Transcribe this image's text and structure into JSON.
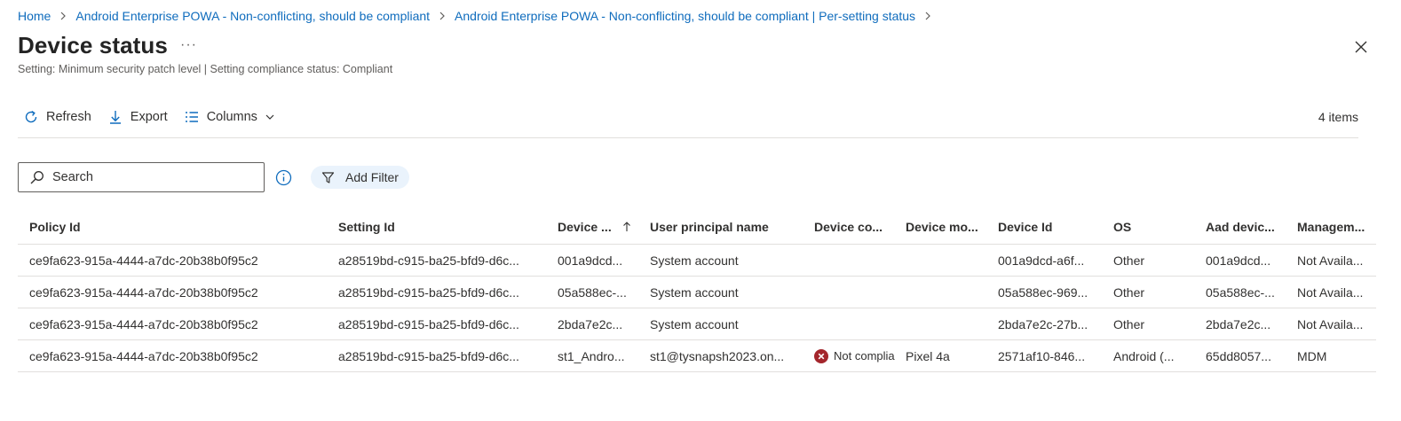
{
  "breadcrumb": {
    "home": "Home",
    "policy": "Android Enterprise POWA - Non-conflicting, should be compliant",
    "per_setting": "Android Enterprise POWA - Non-conflicting, should be compliant | Per-setting status"
  },
  "header": {
    "title": "Device status",
    "more_label": "···",
    "subtitle": "Setting: Minimum security patch level | Setting compliance status: Compliant"
  },
  "toolbar": {
    "refresh": "Refresh",
    "export": "Export",
    "columns": "Columns",
    "item_count": "4 items"
  },
  "search": {
    "placeholder": "Search"
  },
  "filter": {
    "add_filter": "Add Filter"
  },
  "colors": {
    "link": "#0f6cbd",
    "error": "#a4262c",
    "filter_pill": "#eaf3fc"
  },
  "table": {
    "columns": [
      "Policy Id",
      "Setting Id",
      "Device ...",
      "User principal name",
      "Device co...",
      "Device mo...",
      "Device Id",
      "OS",
      "Aad devic...",
      "Managem..."
    ],
    "sorted_column_index": 2,
    "rows": [
      {
        "policy_id": "ce9fa623-915a-4444-a7dc-20b38b0f95c2",
        "setting_id": "a28519bd-c915-ba25-bfd9-d6c...",
        "device_name": "001a9dcd...",
        "upn": "System account",
        "compliance": "",
        "compliance_icon": "",
        "model": "",
        "device_id": "001a9dcd-a6f...",
        "os": "Other",
        "aad_device": "001a9dcd...",
        "management": "Not Availa..."
      },
      {
        "policy_id": "ce9fa623-915a-4444-a7dc-20b38b0f95c2",
        "setting_id": "a28519bd-c915-ba25-bfd9-d6c...",
        "device_name": "05a588ec-...",
        "upn": "System account",
        "compliance": "",
        "compliance_icon": "",
        "model": "",
        "device_id": "05a588ec-969...",
        "os": "Other",
        "aad_device": "05a588ec-...",
        "management": "Not Availa..."
      },
      {
        "policy_id": "ce9fa623-915a-4444-a7dc-20b38b0f95c2",
        "setting_id": "a28519bd-c915-ba25-bfd9-d6c...",
        "device_name": "2bda7e2c...",
        "upn": "System account",
        "compliance": "",
        "compliance_icon": "",
        "model": "",
        "device_id": "2bda7e2c-27b...",
        "os": "Other",
        "aad_device": "2bda7e2c...",
        "management": "Not Availa..."
      },
      {
        "policy_id": "ce9fa623-915a-4444-a7dc-20b38b0f95c2",
        "setting_id": "a28519bd-c915-ba25-bfd9-d6c...",
        "device_name": "st1_Andro...",
        "upn": "st1@tysnapsh2023.on...",
        "compliance": "Not complia",
        "compliance_icon": "error-circle-icon",
        "model": "Pixel 4a",
        "device_id": "2571af10-846...",
        "os": "Android (...",
        "aad_device": "65dd8057...",
        "management": "MDM"
      }
    ]
  }
}
